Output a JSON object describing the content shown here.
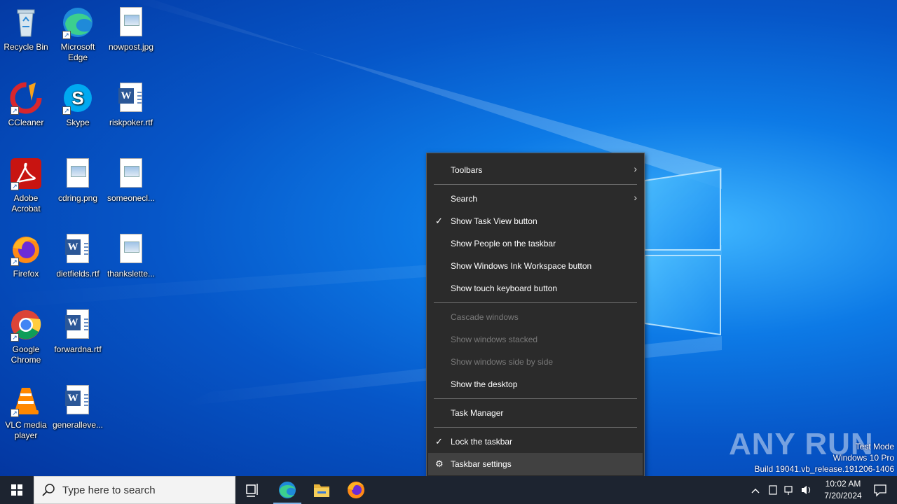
{
  "desktop": {
    "icons": [
      {
        "label": "Recycle Bin"
      },
      {
        "label": "Microsoft Edge"
      },
      {
        "label": "nowpost.jpg"
      },
      {
        "label": "CCleaner"
      },
      {
        "label": "Skype"
      },
      {
        "label": "riskpoker.rtf"
      },
      {
        "label": "Adobe Acrobat"
      },
      {
        "label": "cdring.png"
      },
      {
        "label": "someonecl..."
      },
      {
        "label": "Firefox"
      },
      {
        "label": "dietfields.rtf"
      },
      {
        "label": "thankslette..."
      },
      {
        "label": "Google Chrome"
      },
      {
        "label": "forwardna.rtf"
      },
      {
        "label": "VLC media player"
      },
      {
        "label": "generalleve..."
      }
    ]
  },
  "context_menu": {
    "items": [
      {
        "label": "Toolbars"
      },
      {
        "label": "Search"
      },
      {
        "label": "Show Task View button"
      },
      {
        "label": "Show People on the taskbar"
      },
      {
        "label": "Show Windows Ink Workspace button"
      },
      {
        "label": "Show touch keyboard button"
      },
      {
        "label": "Cascade windows"
      },
      {
        "label": "Show windows stacked"
      },
      {
        "label": "Show windows side by side"
      },
      {
        "label": "Show the desktop"
      },
      {
        "label": "Task Manager"
      },
      {
        "label": "Lock the taskbar"
      },
      {
        "label": "Taskbar settings"
      }
    ]
  },
  "taskbar": {
    "search_placeholder": "Type here to search",
    "time": "10:02 AM",
    "date": "7/20/2024"
  },
  "watermark": {
    "brand": "ANY RUN",
    "line1": "Test Mode",
    "line2": "Windows 10 Pro",
    "line3": "Build 19041.vb_release.191206-1406"
  },
  "colors": {
    "menu_bg": "#2b2b2b",
    "taskbar_bg": "#1d2430",
    "accent": "#0078d7"
  }
}
